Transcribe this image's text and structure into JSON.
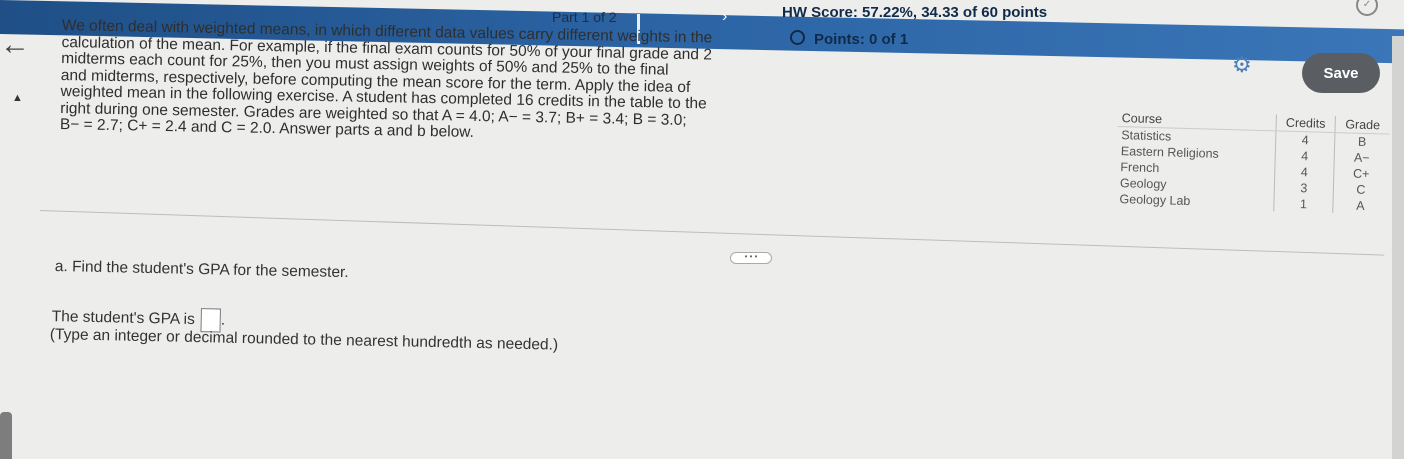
{
  "header": {
    "part_label": "Part 1 of 2",
    "nav_arrow": "›",
    "hw_score": "HW Score: 57.22%, 34.33 of 60 points",
    "points": "Points: 0 of 1",
    "save_label": "Save"
  },
  "icons": {
    "back": "back-arrow-icon",
    "collapse": "collapse-up-icon",
    "settings": "gear-icon",
    "status": "check-circle-icon",
    "more": "more-dots-icon"
  },
  "problem": {
    "lines": [
      "We often deal with weighted means, in which different data values carry different weights in the",
      "calculation of the mean. For example, if the final exam counts for 50% of your final grade and 2",
      "midterms each count for 25%, then you must assign weights of 50% and 25% to the final",
      "and midterms, respectively, before computing the mean score for the term. Apply the idea of",
      "weighted mean in the following exercise. A student has completed 16 credits in the table to the",
      "right during one semester. Grades are weighted so that A = 4.0; A− = 3.7; B+ = 3.4; B = 3.0;",
      "B− = 2.7; C+ = 2.4 and C = 2.0. Answer parts a and b below."
    ]
  },
  "table": {
    "headers": {
      "course": "Course",
      "credits": "Credits",
      "grade": "Grade"
    },
    "rows": [
      {
        "course": "Statistics",
        "credits": "4",
        "grade": "B"
      },
      {
        "course": "Eastern Religions",
        "credits": "4",
        "grade": "A−"
      },
      {
        "course": "French",
        "credits": "4",
        "grade": "C+"
      },
      {
        "course": "Geology",
        "credits": "3",
        "grade": "C"
      },
      {
        "course": "Geology Lab",
        "credits": "1",
        "grade": "A"
      }
    ]
  },
  "question": {
    "part_a": "a. Find the student's GPA for the semester.",
    "answer_prefix": "The student's GPA is",
    "instruction": "(Type an integer or decimal rounded to the nearest hundredth as needed.)"
  }
}
